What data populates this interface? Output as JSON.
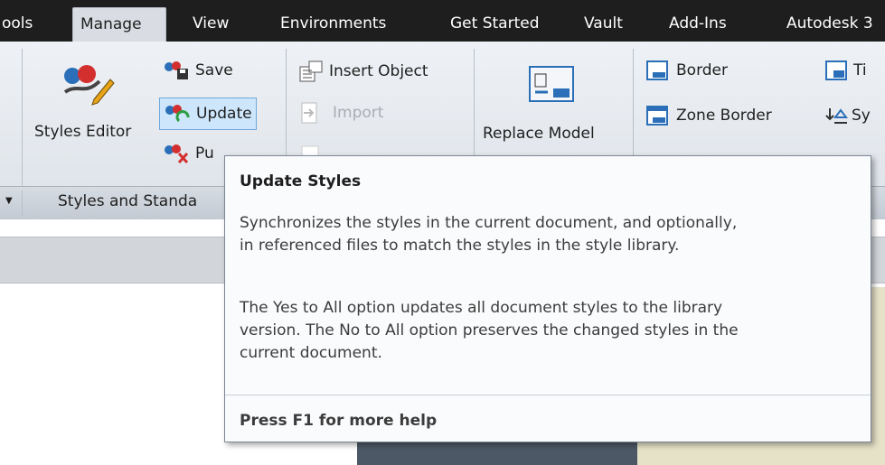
{
  "tabs": [
    {
      "label": "ools",
      "active": false
    },
    {
      "label": "Manage",
      "active": true
    },
    {
      "label": "View",
      "active": false
    },
    {
      "label": "Environments",
      "active": false
    },
    {
      "label": "Get Started",
      "active": false
    },
    {
      "label": "Vault",
      "active": false
    },
    {
      "label": "Add-Ins",
      "active": false
    },
    {
      "label": "Autodesk 3",
      "active": false
    }
  ],
  "ribbon": {
    "styles_editor": "Styles Editor",
    "save": "Save",
    "update": "Update",
    "purge": "Pu",
    "insert_object": "Insert Object",
    "import": "Import",
    "replace_model": "Replace Model",
    "border": "Border",
    "zone_border": "Zone Border",
    "title_block": "Ti",
    "symbol": "Sy"
  },
  "panels": {
    "styles_and_standards": "Styles and Standa"
  },
  "tooltip": {
    "title": "Update Styles",
    "para1_line1": "Synchronizes the styles in the current document, and optionally,",
    "para1_line2": "in referenced files to match the styles in the style library.",
    "para2_line1": "The Yes to All option updates all document styles to the library",
    "para2_line2": "version. The No to All option preserves the changed styles in the",
    "para2_line3": "current document.",
    "help": "Press F1 for more help"
  },
  "colors": {
    "tabbar_bg": "#1e1e1e",
    "ribbon_bg": "#e6eaef",
    "update_highlight": "#cde6fb",
    "icon_blue": "#2a6fb8",
    "icon_red": "#d32f2f"
  }
}
